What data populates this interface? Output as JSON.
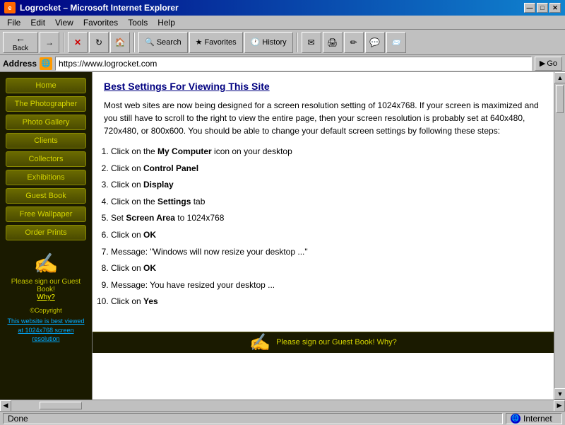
{
  "titlebar": {
    "title": "Logrocket – Microsoft Internet Explorer",
    "icon": "🌐"
  },
  "titlebar_buttons": {
    "minimize": "—",
    "maximize": "□",
    "close": "✕"
  },
  "menubar": {
    "items": [
      "File",
      "Edit",
      "View",
      "Favorites",
      "Tools",
      "Help"
    ]
  },
  "toolbar": {
    "back": "Back",
    "forward": "▶",
    "stop": "✕",
    "refresh": "↻",
    "home": "🏠",
    "search": "Search",
    "favorites": "Favorites",
    "history": "History",
    "mail": "✉",
    "print": "🖨",
    "edit": "✏",
    "discuss": "💬",
    "messenger": "📨"
  },
  "addressbar": {
    "label": "Address",
    "url": "https://www.logrocket.com",
    "go": "Go"
  },
  "sidebar": {
    "nav_items": [
      {
        "label": "Home",
        "key": "home"
      },
      {
        "label": "The Photographer",
        "key": "photographer"
      },
      {
        "label": "Photo Gallery",
        "key": "photo-gallery"
      },
      {
        "label": "Clients",
        "key": "clients"
      },
      {
        "label": "Collectors",
        "key": "collectors"
      },
      {
        "label": "Exhibitions",
        "key": "exhibitions"
      },
      {
        "label": "Guest Book",
        "key": "guest-book"
      },
      {
        "label": "Free Wallpaper",
        "key": "free-wallpaper"
      },
      {
        "label": "Order Prints",
        "key": "order-prints"
      }
    ],
    "guestbook_prompt": "Please sign our Guest Book!",
    "why_label": "Why?",
    "copyright": "©Copyright",
    "resolution_note": "This website is best viewed at 1024x768 screen resolution"
  },
  "content": {
    "title": "Best Settings For Viewing This Site",
    "intro": "Most web sites are now being designed for a screen resolution setting of 1024x768. If your screen is maximized and you still have to scroll to the right to view the entire page, then your screen resolution is probably set at 640x480, 720x480, or 800x600. You should be able to change your default screen settings by following these steps:",
    "steps": [
      {
        "num": "1.",
        "text": "Click on the ",
        "bold": "My Computer",
        "rest": " icon on your desktop"
      },
      {
        "num": "2.",
        "text": "Click on ",
        "bold": "Control Panel",
        "rest": ""
      },
      {
        "num": "3.",
        "text": "Click on ",
        "bold": "Display",
        "rest": ""
      },
      {
        "num": "4.",
        "text": "Click on the ",
        "bold": "Settings",
        "rest": " tab"
      },
      {
        "num": "5.",
        "text": "Set ",
        "bold": "Screen Area",
        "rest": " to 1024x768"
      },
      {
        "num": "6.",
        "text": "Click on ",
        "bold": "OK",
        "rest": ""
      },
      {
        "num": "7.",
        "text": "Message: \"Windows will now resize your desktop ...\"",
        "bold": "",
        "rest": ""
      },
      {
        "num": "8.",
        "text": "Click on ",
        "bold": "OK",
        "rest": ""
      },
      {
        "num": "9.",
        "text": "Message: You have resized your desktop ...",
        "bold": "",
        "rest": ""
      },
      {
        "num": "10.",
        "text": "Click on ",
        "bold": "Yes",
        "rest": ""
      }
    ]
  },
  "statusbar": {
    "status": "Done",
    "zone": "Internet"
  },
  "bottom_teaser": "Please sign our Guest Book!  Why?"
}
